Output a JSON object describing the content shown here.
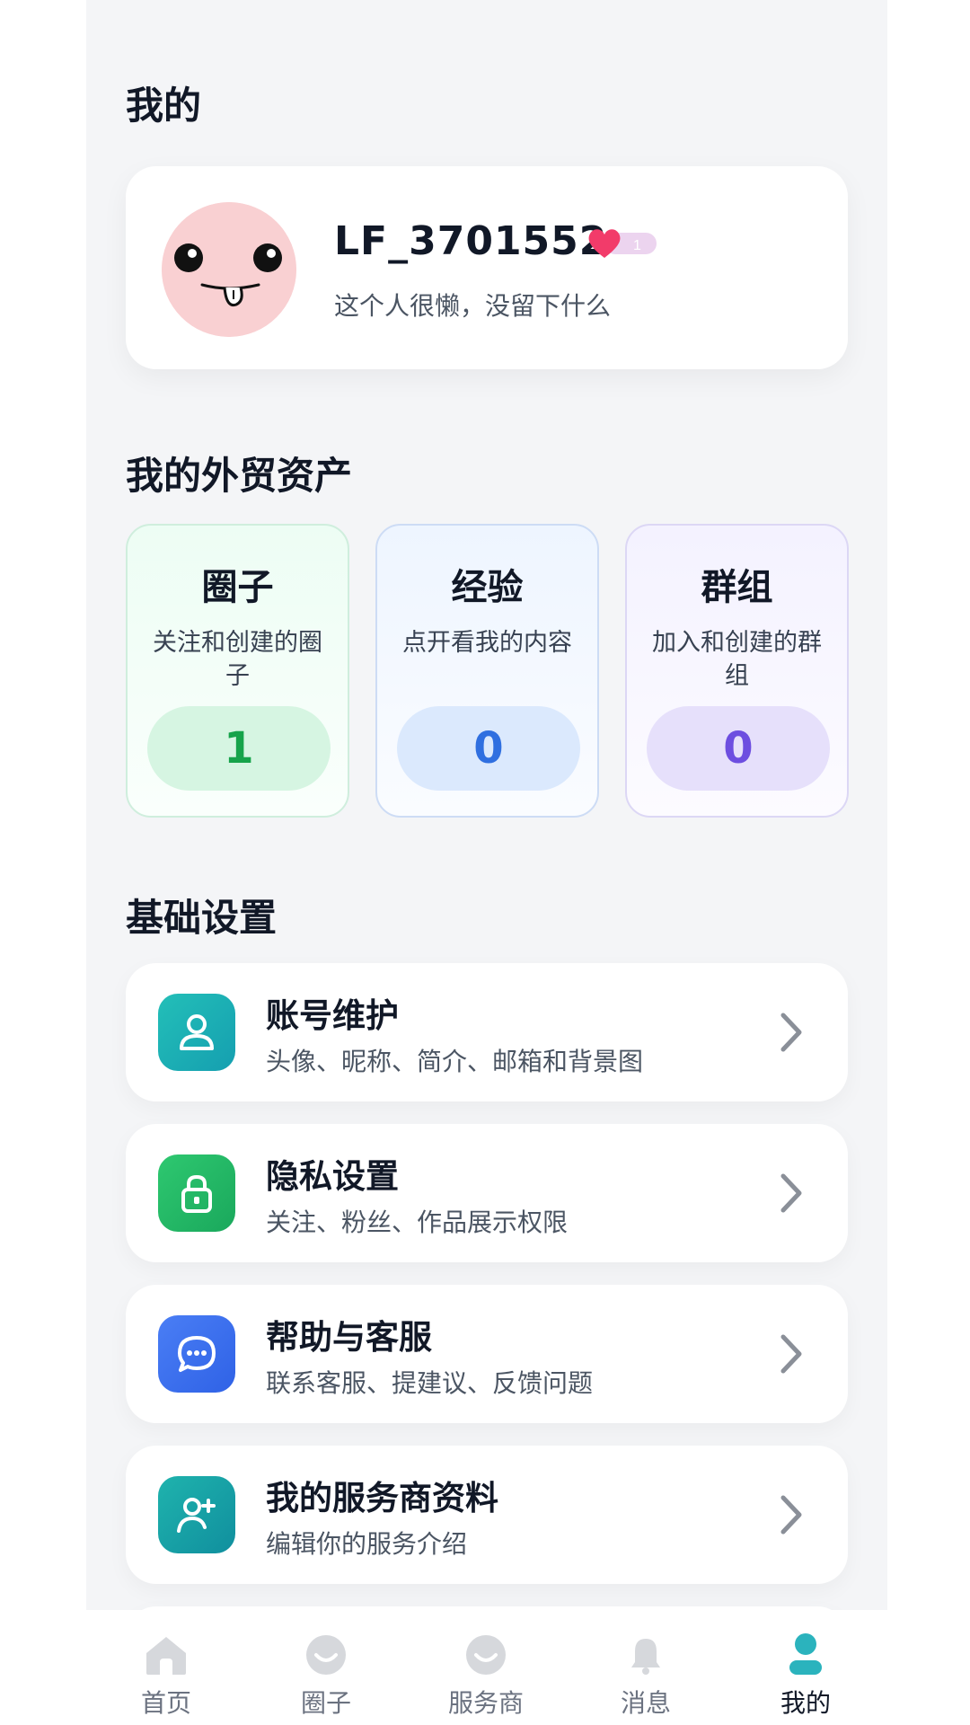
{
  "page_title": "我的",
  "profile": {
    "username": "LF_3701552",
    "level": "1",
    "bio": "这个人很懒，没留下什么"
  },
  "assets": {
    "title": "我的外贸资产",
    "items": [
      {
        "title": "圈子",
        "desc": "关注和创建的圈子",
        "count": "1",
        "color": "#16a34a"
      },
      {
        "title": "经验",
        "desc": "点开看我的内容",
        "count": "0",
        "color": "#2f6fe0"
      },
      {
        "title": "群组",
        "desc": "加入和创建的群组",
        "count": "0",
        "color": "#6d4ee0"
      }
    ]
  },
  "settings": {
    "title": "基础设置",
    "items": [
      {
        "title": "账号维护",
        "sub": "头像、昵称、简介、邮箱和背景图",
        "icon": "user-icon"
      },
      {
        "title": "隐私设置",
        "sub": "关注、粉丝、作品展示权限",
        "icon": "lock-icon"
      },
      {
        "title": "帮助与客服",
        "sub": "联系客服、提建议、反馈问题",
        "icon": "chat-icon"
      },
      {
        "title": "我的服务商资料",
        "sub": "编辑你的服务介绍",
        "icon": "user-plus-icon"
      }
    ]
  },
  "tabs": [
    {
      "label": "首页",
      "icon": "home-icon"
    },
    {
      "label": "圈子",
      "icon": "circle-icon"
    },
    {
      "label": "服务商",
      "icon": "provider-icon"
    },
    {
      "label": "消息",
      "icon": "bell-icon"
    },
    {
      "label": "我的",
      "icon": "profile-icon",
      "active": true
    }
  ],
  "colors": {
    "accent": "#2bb3bd",
    "account_icon": "#1cb0b2",
    "privacy_icon": "#22b86a",
    "help_icon": "#3b6ff0",
    "provider_icon": "#16a3a6"
  }
}
